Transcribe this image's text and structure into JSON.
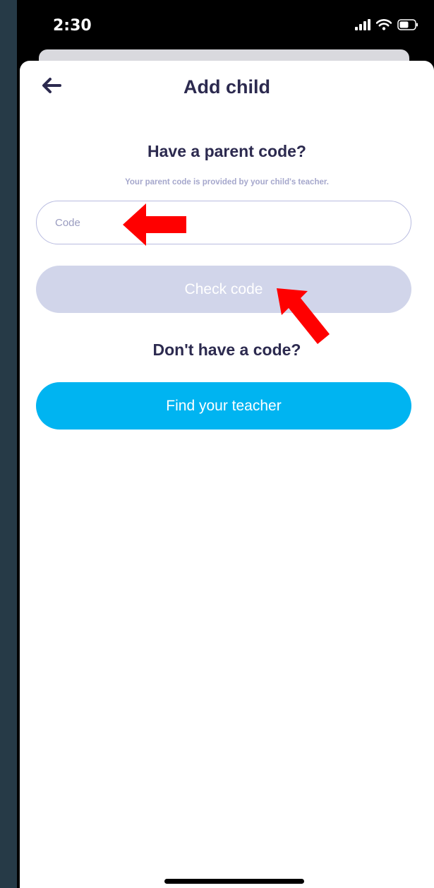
{
  "status_bar": {
    "time": "2:30",
    "icons": [
      "signal-icon",
      "wifi-icon",
      "battery-icon"
    ]
  },
  "header": {
    "title": "Add child",
    "back_icon": "back-arrow-icon"
  },
  "parent_code": {
    "title": "Have a parent code?",
    "helper": "Your parent code is provided by your child's teacher.",
    "input_placeholder": "Code",
    "input_value": "",
    "check_label": "Check code"
  },
  "no_code": {
    "title": "Don't have a code?",
    "find_label": "Find your teacher"
  },
  "colors": {
    "primary_text": "#2c2a4f",
    "accent": "#00b4f1",
    "disabled_button": "#d1d5ea",
    "annotation_arrow": "#ff0000"
  }
}
